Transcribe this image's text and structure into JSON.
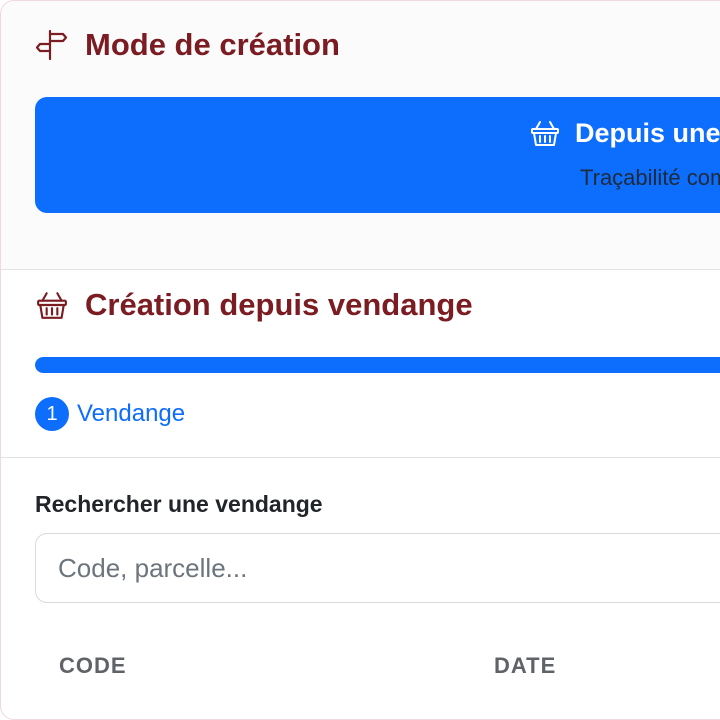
{
  "mode_section": {
    "title": "Mode de création",
    "title_icon": "signpost-icon",
    "option": {
      "title": "Depuis une vendange",
      "icon": "basket-icon",
      "subtitle": "Traçabilité complète"
    }
  },
  "creation_section": {
    "title": "Création depuis vendange",
    "title_icon": "basket-icon",
    "progress_fraction": 1.0,
    "step": {
      "number": "1",
      "label": "Vendange"
    }
  },
  "search": {
    "label": "Rechercher une vendange",
    "placeholder": "Code, parcelle..."
  },
  "table": {
    "headers": [
      "CODE",
      "DATE"
    ]
  },
  "colors": {
    "accent": "#0d6efd",
    "title": "#7b1c22"
  }
}
